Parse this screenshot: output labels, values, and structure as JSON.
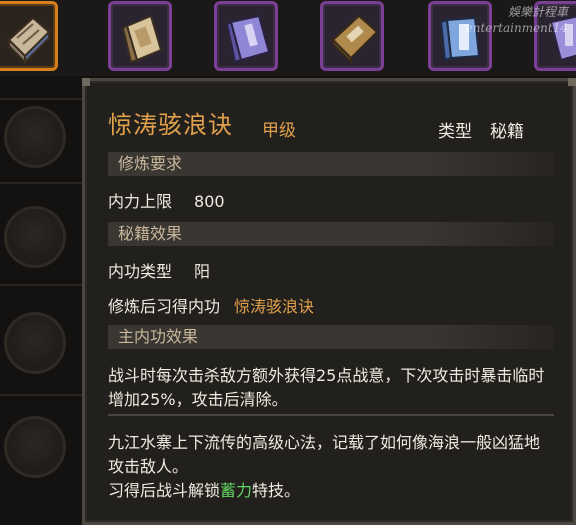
{
  "watermark": {
    "line1": "娛樂計程車",
    "line2": "entertainment14"
  },
  "inventory": {
    "slots": [
      {
        "icon": "scroll-book-icon",
        "selected": true
      },
      {
        "icon": "tan-book-icon"
      },
      {
        "icon": "purple-book-icon"
      },
      {
        "icon": "brown-book-icon"
      },
      {
        "icon": "blue-book-icon"
      },
      {
        "icon": "purple-book-icon"
      }
    ]
  },
  "tooltip": {
    "name": "惊涛骇浪诀",
    "grade": "甲级",
    "type_label": "类型",
    "type_value": "秘籍",
    "sections": {
      "requirements": {
        "header": "修炼要求",
        "neili_label": "内力上限",
        "neili_value": "800"
      },
      "effects": {
        "header": "秘籍效果",
        "neigong_type_label": "内功类型",
        "neigong_type_value": "阳",
        "learn_label": "修炼后习得内功",
        "learn_value": "惊涛骇浪诀"
      },
      "main_effect": {
        "header": "主内功效果",
        "text": "战斗时每次击杀敌方额外获得25点战意，下次攻击时暴击临时增加25%，攻击后清除。"
      }
    },
    "lore": {
      "text": "九江水寨上下流传的高级心法，记载了如何像海浪一般凶猛地攻击敌人。",
      "unlock_prefix": "习得后战斗解锁",
      "unlock_skill": "蓄力",
      "unlock_suffix": "特技。"
    }
  },
  "colors": {
    "gold": "#e0a04b",
    "text": "#f0ebe0",
    "green": "#61d262",
    "slot_border_purple": "#7b3f98",
    "slot_border_selected": "#d77f1c"
  }
}
